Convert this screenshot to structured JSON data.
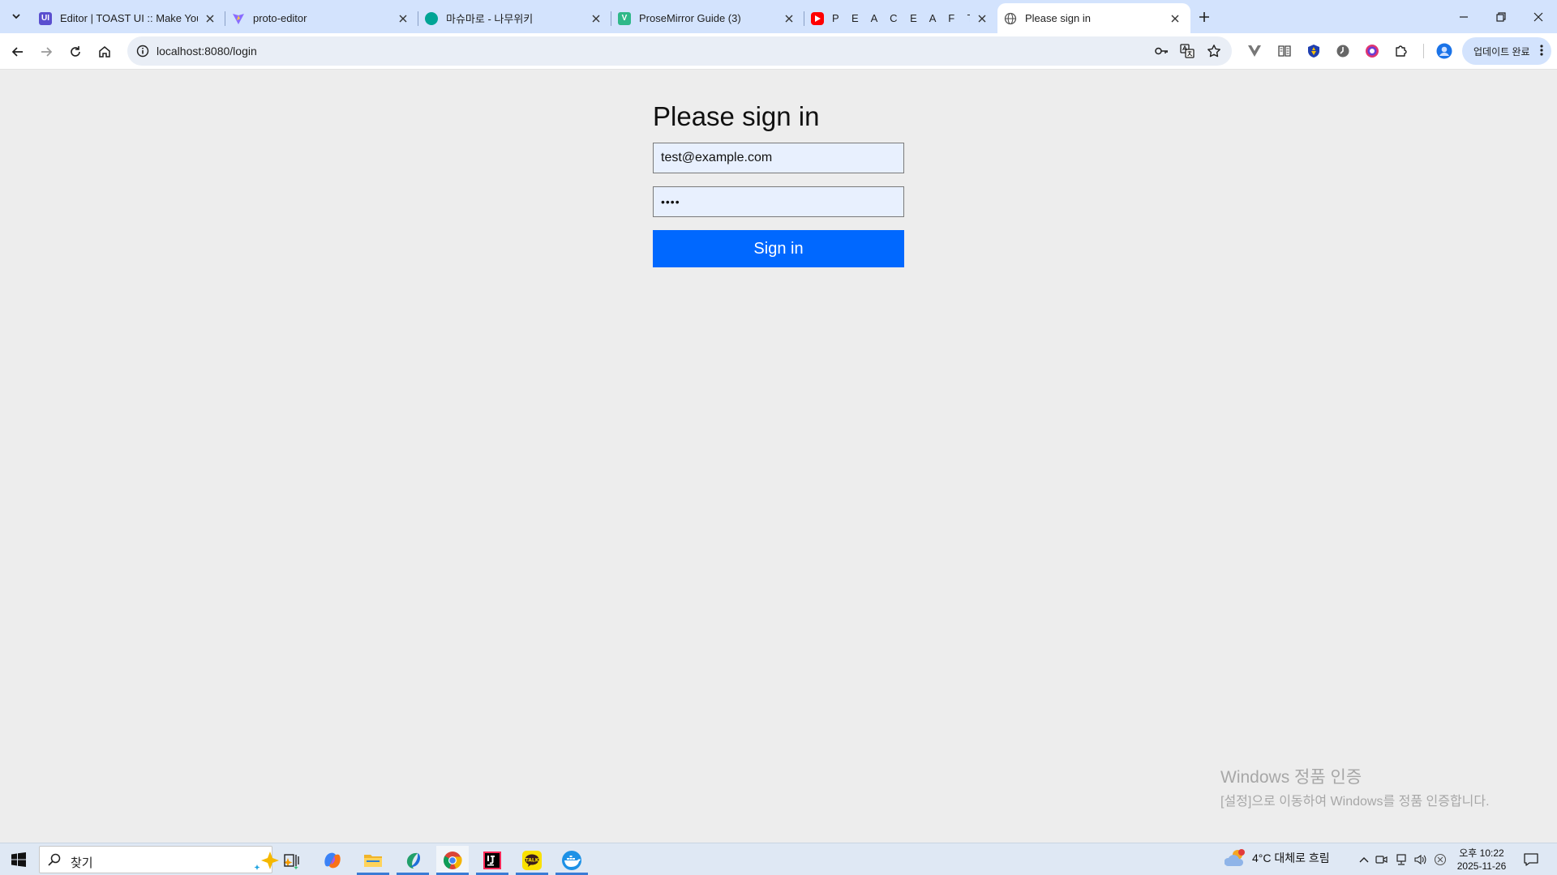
{
  "browser": {
    "tabs": [
      {
        "title": "Editor | TOAST UI :: Make Your",
        "favicon": "toast-ui-icon",
        "active": false
      },
      {
        "title": "proto-editor",
        "favicon": "vite-icon",
        "active": false
      },
      {
        "title": "마슈마로 - 나무위키",
        "favicon": "namuwiki-icon",
        "active": false
      },
      {
        "title": "ProseMirror Guide (3)",
        "favicon": "vue-icon",
        "active": false
      },
      {
        "title": "P E A C E   A F T E R   H O",
        "favicon": "youtube-icon",
        "active": false
      },
      {
        "title": "Please sign in",
        "favicon": "globe-icon",
        "active": true
      }
    ],
    "url": "localhost:8080/login",
    "update_button": "업데이트 완료"
  },
  "login": {
    "heading": "Please sign in",
    "username_value": "test@example.com",
    "password_value": "••••",
    "submit_label": "Sign in"
  },
  "watermark": {
    "line1": "Windows 정품 인증",
    "line2": "[설정]으로 이동하여 Windows를 정품 인증합니다."
  },
  "taskbar": {
    "search_placeholder": "찾기",
    "weather": "4°C  대체로 흐림",
    "time": "오후 10:22",
    "date": "2025-11-26"
  },
  "colors": {
    "tabstrip": "#d3e3fd",
    "accent_button": "#0068ff",
    "page_bg": "#ededed"
  }
}
